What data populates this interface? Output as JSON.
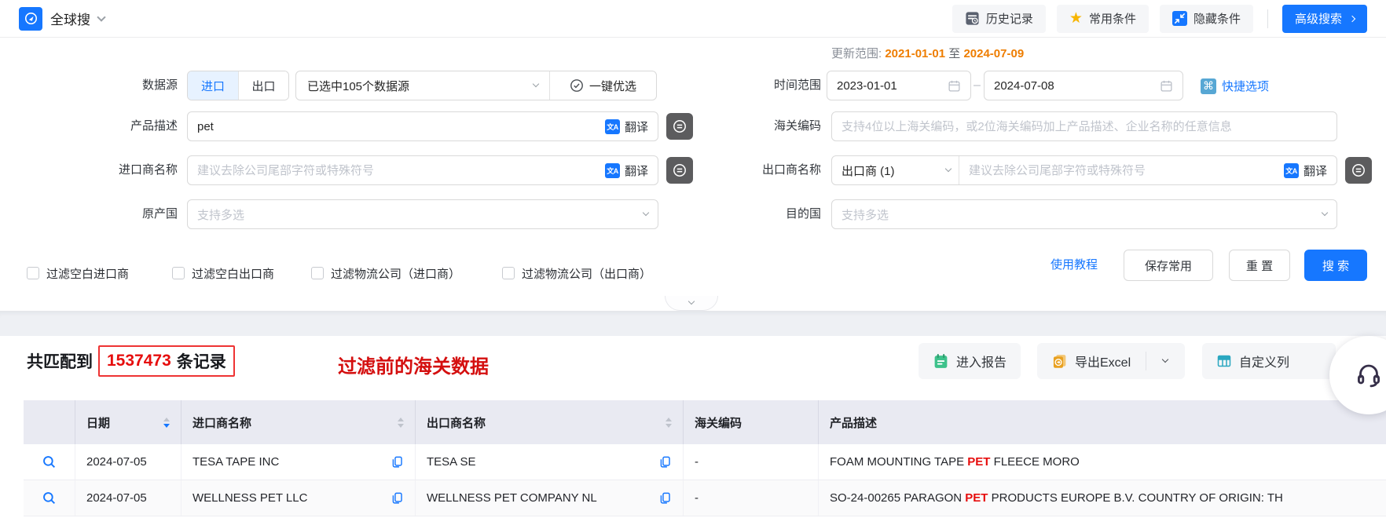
{
  "topbar": {
    "app_title": "全球搜",
    "history_label": "历史记录",
    "favorites_label": "常用条件",
    "hide_label": "隐藏条件",
    "advanced_label": "高级搜索"
  },
  "form": {
    "update_range": {
      "label": "更新范围:",
      "start": "2021-01-01",
      "to": "至",
      "end": "2024-07-09"
    },
    "data_source": {
      "label": "数据源",
      "import_tab": "进口",
      "export_tab": "出口",
      "selected_text": "已选中105个数据源",
      "optimize_label": "一键优选"
    },
    "time_range": {
      "label": "时间范围",
      "start": "2023-01-01",
      "separator": "–",
      "end": "2024-07-08",
      "quick_label": "快捷选项"
    },
    "product_desc": {
      "label": "产品描述",
      "value": "pet",
      "translate_label": "翻译"
    },
    "hs_code": {
      "label": "海关编码",
      "placeholder": "支持4位以上海关编码，或2位海关编码加上产品描述、企业名称的任意信息"
    },
    "importer": {
      "label": "进口商名称",
      "placeholder": "建议去除公司尾部字符或特殊符号",
      "translate_label": "翻译"
    },
    "exporter": {
      "label": "出口商名称",
      "type_selector": "出口商 (1)",
      "placeholder": "建议去除公司尾部字符或特殊符号",
      "translate_label": "翻译"
    },
    "origin": {
      "label": "原产国",
      "placeholder": "支持多选"
    },
    "destination": {
      "label": "目的国",
      "placeholder": "支持多选"
    },
    "filters": [
      "过滤空白进口商",
      "过滤空白出口商",
      "过滤物流公司（进口商）",
      "过滤物流公司（出口商）"
    ],
    "tutorial_label": "使用教程",
    "save_label": "保存常用",
    "reset_label": "重 置",
    "search_label": "搜 索"
  },
  "results": {
    "match_prefix": "共匹配到",
    "match_count": "1537473",
    "match_suffix": "条记录",
    "annotation": "过滤前的海关数据",
    "report_label": "进入报告",
    "export_label": "导出Excel",
    "customize_label": "自定义列"
  },
  "table": {
    "columns": {
      "date": "日期",
      "importer": "进口商名称",
      "exporter": "出口商名称",
      "hs_code": "海关编码",
      "product_desc": "产品描述"
    },
    "date_sort": "desc",
    "rows": [
      {
        "date": "2024-07-05",
        "importer": "TESA TAPE INC",
        "exporter": "TESA SE",
        "hs_code": "-",
        "desc_before": "FOAM MOUNTING TAPE ",
        "desc_keyword": "PET",
        "desc_after": " FLEECE MORO"
      },
      {
        "date": "2024-07-05",
        "importer": "WELLNESS PET LLC",
        "exporter": "WELLNESS PET COMPANY NL",
        "hs_code": "-",
        "desc_before": "SO-24-00265 PARAGON ",
        "desc_keyword": "PET",
        "desc_after": " PRODUCTS EUROPE B.V. COUNTRY OF ORIGIN: TH"
      }
    ]
  },
  "colors": {
    "accent": "#1677ff",
    "update_orange": "#ee7d00",
    "keyword_red": "#e60d0d",
    "annotation_red": "#d40f0f",
    "star_gold": "#f7b500"
  }
}
